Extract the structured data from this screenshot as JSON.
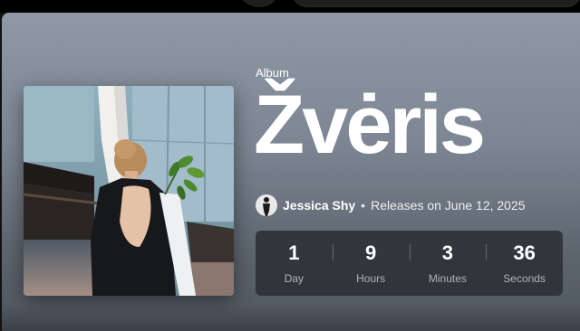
{
  "album": {
    "type_label": "Album",
    "title": "Žvėris",
    "artist": "Jessica Shy",
    "separator": "•",
    "release_text": "Releases on June 12, 2025"
  },
  "countdown": [
    {
      "value": "1",
      "label": "Day"
    },
    {
      "value": "9",
      "label": "Hours"
    },
    {
      "value": "3",
      "label": "Minutes"
    },
    {
      "value": "36",
      "label": "Seconds"
    }
  ]
}
